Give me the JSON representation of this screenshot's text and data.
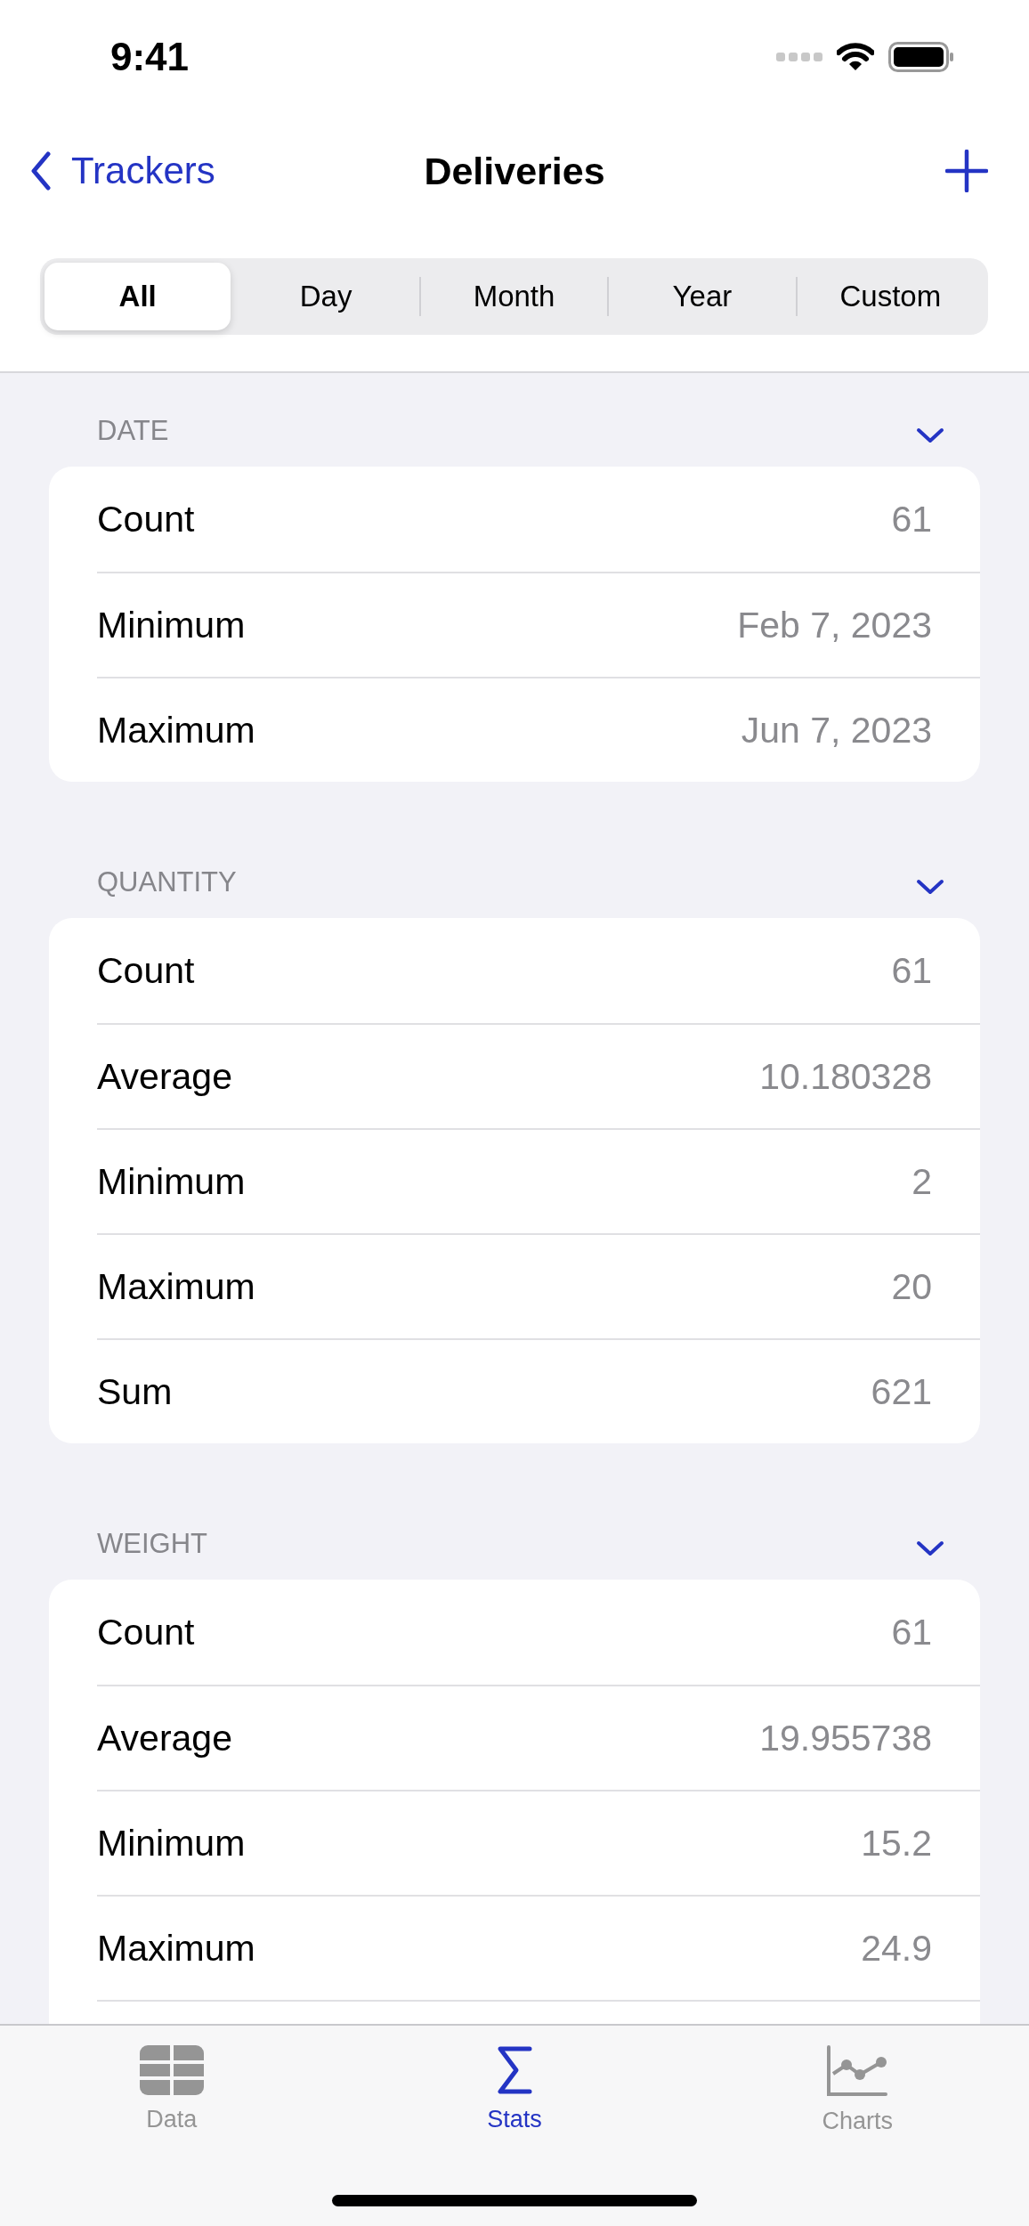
{
  "status_bar": {
    "time": "9:41"
  },
  "nav": {
    "back": "Trackers",
    "title": "Deliveries"
  },
  "segments": [
    {
      "label": "All",
      "selected": true
    },
    {
      "label": "Day",
      "selected": false
    },
    {
      "label": "Month",
      "selected": false
    },
    {
      "label": "Year",
      "selected": false
    },
    {
      "label": "Custom",
      "selected": false
    }
  ],
  "sections": [
    {
      "title": "DATE",
      "expanded": true,
      "rows": [
        {
          "label": "Count",
          "value": "61"
        },
        {
          "label": "Minimum",
          "value": "Feb 7, 2023"
        },
        {
          "label": "Maximum",
          "value": "Jun 7, 2023"
        }
      ]
    },
    {
      "title": "QUANTITY",
      "expanded": true,
      "rows": [
        {
          "label": "Count",
          "value": "61"
        },
        {
          "label": "Average",
          "value": "10.180328"
        },
        {
          "label": "Minimum",
          "value": "2"
        },
        {
          "label": "Maximum",
          "value": "20"
        },
        {
          "label": "Sum",
          "value": "621"
        }
      ]
    },
    {
      "title": "WEIGHT",
      "expanded": true,
      "rows": [
        {
          "label": "Count",
          "value": "61"
        },
        {
          "label": "Average",
          "value": "19.955738"
        },
        {
          "label": "Minimum",
          "value": "15.2"
        },
        {
          "label": "Maximum",
          "value": "24.9"
        }
      ]
    }
  ],
  "tab_bar": [
    {
      "kind": "table",
      "label": "Data",
      "selected": false
    },
    {
      "kind": "sigma",
      "label": "Stats",
      "selected": true
    },
    {
      "kind": "chart",
      "label": "Charts",
      "selected": false
    }
  ]
}
